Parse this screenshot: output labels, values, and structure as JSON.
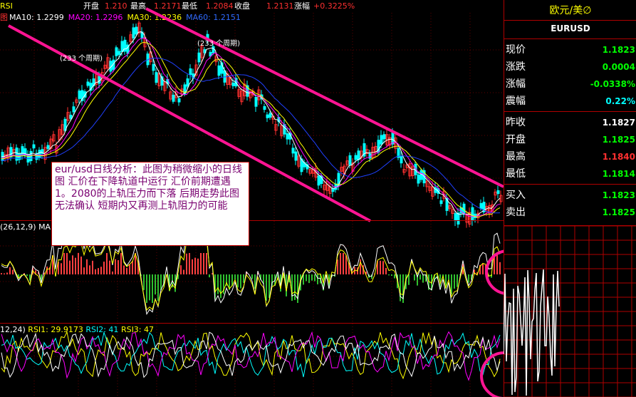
{
  "topbar": {
    "open_label": "开盘",
    "open_value": "1.210",
    "high_label": "最高",
    "high_value": "1.2171",
    "low_label": "最低",
    "low_value": "1.2084",
    "close_label": "收盘",
    "close_value": "1.2131",
    "change_label": "涨幅",
    "change_value": "+0.3225%",
    "left_tag": "RSI"
  },
  "ma_row": {
    "prefix": "图",
    "ma10": "MA10: 1.2299",
    "ma20": "MA20: 1.2296",
    "ma30": "MA30: 1.2236",
    "ma60": "MA60: 1.2151"
  },
  "period_labels": [
    "(233 个周期)",
    "(233 个周期)"
  ],
  "annotation": "eur/usd日线分析：此图为稍微缩小的日线图 汇价在下降轨道中运行 汇价前期遭遇1。2080的上轨压力而下落 后期走势此图无法确认 短期内又再测上轨阻力的可能",
  "macd_label": "(26,12,9) MA",
  "rsi_row": {
    "params": "12,24)",
    "rsi1": "RSI1: 29.9173",
    "rsi2": "RSI2: 41",
    "rsi3": "RSI3: 47"
  },
  "side": {
    "title": "欧元/美∅",
    "code": "EURUSD",
    "rows": [
      {
        "k": "现价",
        "v": "1.1823",
        "color": "#00ff00"
      },
      {
        "k": "涨跌",
        "v": "0.0004",
        "color": "#00ff00"
      },
      {
        "k": "涨幅",
        "v": "-0.0338%",
        "color": "#00ff00"
      },
      {
        "k": "震幅",
        "v": "0.22%",
        "color": "#00ffff"
      },
      {
        "k": "昨收",
        "v": "1.1827",
        "color": "#ffffff"
      },
      {
        "k": "开盘",
        "v": "1.1825",
        "color": "#00ff00"
      },
      {
        "k": "最高",
        "v": "1.1840",
        "color": "#ff3030"
      },
      {
        "k": "最低",
        "v": "1.1814",
        "color": "#00ff00"
      },
      {
        "k": "买入",
        "v": "1.1823",
        "color": "#00ff00"
      },
      {
        "k": "卖出",
        "v": "1.1825",
        "color": "#00ff00"
      }
    ]
  },
  "colors": {
    "channel": "#ff1493",
    "ma10": "#ffffff",
    "ma20": "#ff00ff",
    "ma30": "#ffff00",
    "ma60": "#2040ff",
    "bull": "#ff4040",
    "bear": "#00ffff",
    "grid": "#b00000"
  }
}
